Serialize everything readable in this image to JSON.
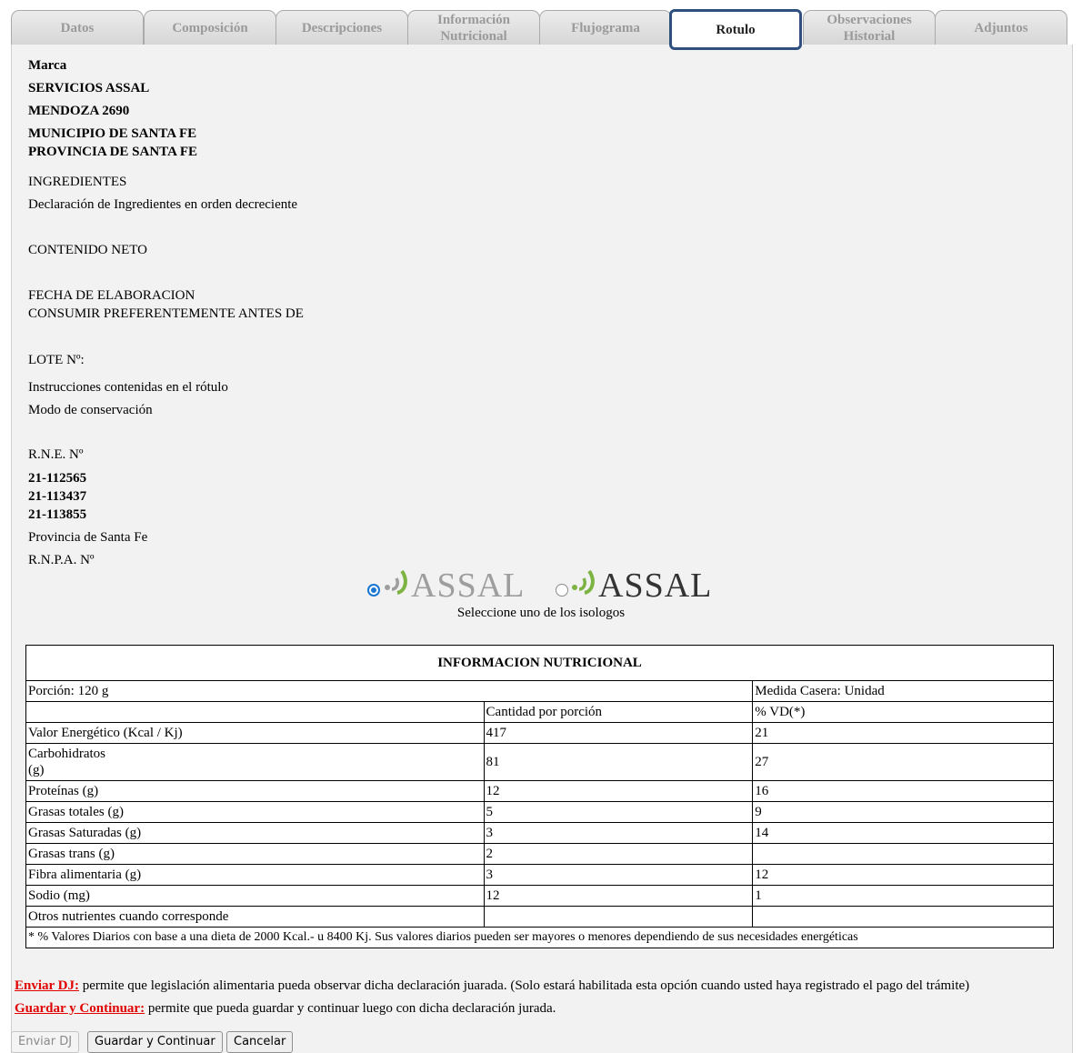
{
  "tabs": [
    {
      "label": "Datos"
    },
    {
      "label": "Composición"
    },
    {
      "label": "Descripciones"
    },
    {
      "label": "Información Nutricional"
    },
    {
      "label": "Flujograma"
    },
    {
      "label": "Rotulo",
      "active": true
    },
    {
      "label": "Observaciones Historial"
    },
    {
      "label": "Adjuntos"
    }
  ],
  "label": {
    "marca": "Marca",
    "entity": "SERVICIOS ASSAL",
    "address": "MENDOZA 2690",
    "municipio": "MUNICIPIO DE SANTA FE",
    "provincia": "PROVINCIA DE SANTA FE",
    "ingredientes_title": "INGREDIENTES",
    "ingredientes_text": "Declaración de Ingredientes en orden decreciente",
    "contenido_neto": "CONTENIDO NETO",
    "fecha_elaboracion": "FECHA DE ELABORACION",
    "consumir": "CONSUMIR PREFERENTEMENTE ANTES DE",
    "lote": "LOTE Nº:",
    "instrucciones": "Instrucciones contenidas en el rótulo",
    "modo_conservacion": "Modo de conservación",
    "rne_label": "R.N.E. Nº",
    "rne_1": "21-112565",
    "rne_2": "21-113437",
    "rne_3": "21-113855",
    "provincia_santa_fe": "Provincia de Santa Fe",
    "rnpa_label": "R.N.P.A. Nº"
  },
  "isologos": {
    "logo_text_1": "ASSAL",
    "logo_text_2": "ASSAL",
    "caption": "Seleccione uno de los isologos",
    "selected": 1
  },
  "nutrition": {
    "title": "INFORMACION NUTRICIONAL",
    "porcion": "Porción: 120 g",
    "medida": "Medida Casera: Unidad",
    "col_cantidad": "Cantidad por porción",
    "col_vd": "% VD(*)",
    "rows": [
      {
        "name": "Valor Energético (Kcal / Kj)",
        "qty": "417",
        "vd": "21"
      },
      {
        "name": "Carbohidratos",
        "unit": "(g)",
        "qty": "81",
        "vd": "27"
      },
      {
        "name": "Proteínas (g)",
        "qty": "12",
        "vd": "16"
      },
      {
        "name": "Grasas totales (g)",
        "qty": "5",
        "vd": "9"
      },
      {
        "name": "Grasas Saturadas (g)",
        "qty": "3",
        "vd": "14"
      },
      {
        "name": "Grasas trans (g)",
        "qty": "2",
        "vd": ""
      },
      {
        "name": "Fibra alimentaria (g)",
        "qty": "3",
        "vd": "12"
      },
      {
        "name": "Sodio (mg)",
        "qty": "12",
        "vd": "1"
      },
      {
        "name": "Otros nutrientes cuando corresponde",
        "qty": "",
        "vd": ""
      }
    ],
    "footnote": "* % Valores Diarios con base a una dieta de 2000 Kcal.- u 8400 Kj. Sus valores diarios pueden ser mayores o menores dependiendo de sus necesidades energéticas"
  },
  "help": {
    "enviar_key": "Enviar DJ:",
    "enviar_text": " permite que legislación alimentaria pueda observar dicha declaración juarada. (Solo estará habilitada esta opción cuando usted haya registrado el pago del trámite)",
    "guardar_key": "Guardar y Continuar:",
    "guardar_text": " permite que pueda guardar y continuar luego con dicha declaración jurada."
  },
  "buttons": {
    "enviar": "Enviar DJ",
    "guardar": "Guardar y Continuar",
    "cancelar": "Cancelar"
  },
  "colors": {
    "active_tab_border": "#2f4f7f",
    "logo_green": "#7cb342",
    "logo_gray": "#9e9e9e",
    "radio_selected": "#1976d2",
    "help_keyword": "#e00000"
  }
}
